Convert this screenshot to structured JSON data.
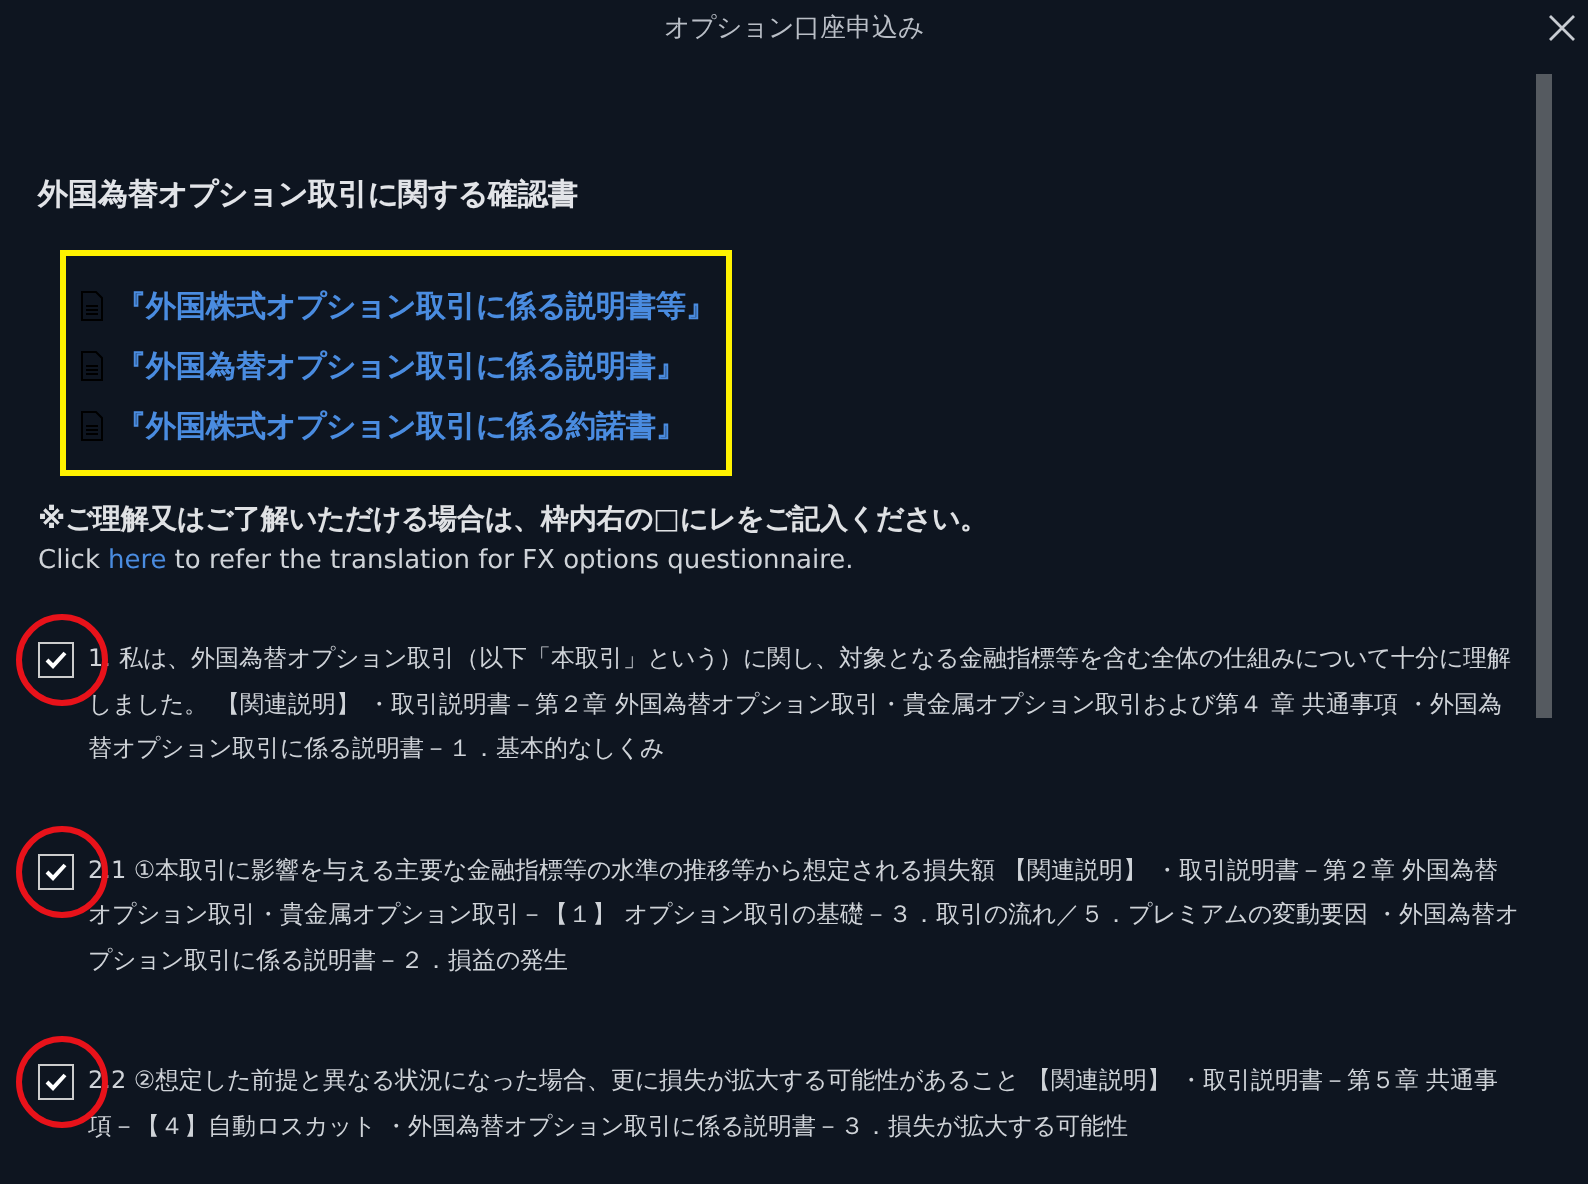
{
  "window": {
    "title": "オプション口座申込み"
  },
  "heading": "外国為替オプション取引に関する確認書",
  "documents": [
    {
      "label": "『外国株式オプション取引に係る説明書等』"
    },
    {
      "label": "『外国為替オプション取引に係る説明書』"
    },
    {
      "label": "『外国株式オプション取引に係る約諾書』"
    }
  ],
  "notice": "※ご理解又はご了解いただける場合は、枠内右の□にレをご記入ください。",
  "translation_note": {
    "before": "Click",
    "link": "here",
    "after": "to refer the translation for FX options questionnaire."
  },
  "items": [
    {
      "text": "1. 私は、外国為替オプション取引（以下「本取引」という）に関し、対象となる金融指標等を含む全体の仕組みについて十分に理解しました。 【関連説明】 ・取引説明書－第２章 外国為替オプション取引・貴金属オプション取引および第４ 章 共通事項 ・外国為替オプション取引に係る説明書－１．基本的なしくみ",
      "checked": true,
      "circled": true
    },
    {
      "text": "2.1 ①本取引に影響を与える主要な金融指標等の水準の推移等から想定される損失額 【関連説明】 ・取引説明書－第２章 外国為替オプション取引・貴金属オプション取引－【１】 オプション取引の基礎－３．取引の流れ／５．プレミアムの変動要因 ・外国為替オプション取引に係る説明書－２．損益の発生",
      "checked": true,
      "circled": true
    },
    {
      "text": "2.2 ②想定した前提と異なる状況になった場合、更に損失が拡大する可能性があること 【関連説明】 ・取引説明書－第５章 共通事項－【４】自動ロスカット ・外国為替オプション取引に係る説明書－３．損失が拡大する可能性",
      "checked": true,
      "circled": true
    }
  ]
}
